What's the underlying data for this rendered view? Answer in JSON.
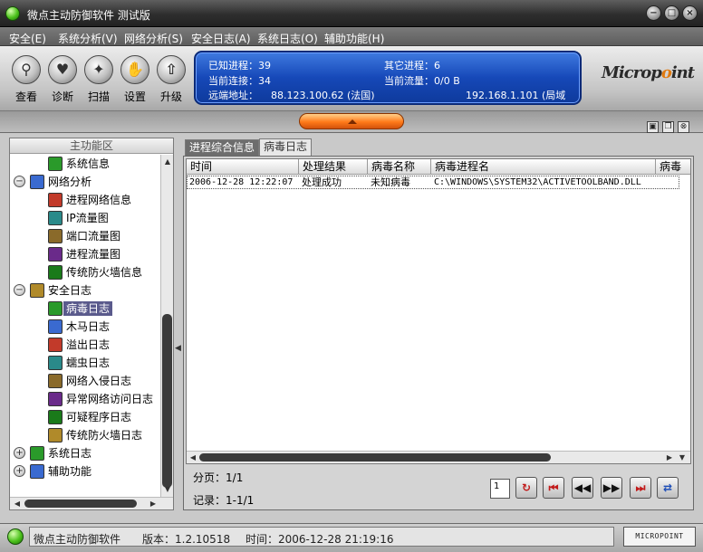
{
  "window": {
    "title": "微点主动防御软件  测试版"
  },
  "menu": [
    "安全(E)",
    "系统分析(V)",
    "网络分析(S)",
    "安全日志(A)",
    "系统日志(O)",
    "辅助功能(H)"
  ],
  "toolbar": [
    {
      "label": "查看",
      "icon": "magnifier-icon"
    },
    {
      "label": "诊断",
      "icon": "heart-check-icon"
    },
    {
      "label": "扫描",
      "icon": "scan-icon"
    },
    {
      "label": "设置",
      "icon": "hand-icon"
    },
    {
      "label": "升级",
      "icon": "upgrade-icon"
    }
  ],
  "info": {
    "known_proc_label": "已知进程：",
    "known_proc": "39",
    "other_proc_label": "其它进程：",
    "other_proc": "6",
    "conn_label": "当前连接：",
    "conn": "34",
    "traffic_label": "当前流量：",
    "traffic": "0/0 B",
    "remote_label": "远端地址：",
    "remote": "88.123.100.62 (法国)",
    "local": "192.168.1.101 (局域"
  },
  "brand": {
    "logo_pre": "Micrоp",
    "logo_o": "o",
    "logo_post": "int"
  },
  "left": {
    "header": "主功能区",
    "tree": [
      {
        "label": "系统信息",
        "level": 1
      },
      {
        "label": "网络分析",
        "level": 0,
        "exp": "−"
      },
      {
        "label": "进程网络信息",
        "level": 1
      },
      {
        "label": "IP流量图",
        "level": 1
      },
      {
        "label": "端口流量图",
        "level": 1
      },
      {
        "label": "进程流量图",
        "level": 1
      },
      {
        "label": "传统防火墙信息",
        "level": 1
      },
      {
        "label": "安全日志",
        "level": 0,
        "exp": "−"
      },
      {
        "label": "病毒日志",
        "level": 1,
        "selected": true
      },
      {
        "label": "木马日志",
        "level": 1
      },
      {
        "label": "溢出日志",
        "level": 1
      },
      {
        "label": "蠕虫日志",
        "level": 1
      },
      {
        "label": "网络入侵日志",
        "level": 1
      },
      {
        "label": "异常网络访问日志",
        "level": 1
      },
      {
        "label": "可疑程序日志",
        "level": 1
      },
      {
        "label": "传统防火墙日志",
        "level": 1
      },
      {
        "label": "系统日志",
        "level": 0,
        "exp": "+"
      },
      {
        "label": "辅助功能",
        "level": 0,
        "exp": "+"
      }
    ]
  },
  "tabs": [
    "进程综合信息",
    "病毒日志"
  ],
  "table": {
    "columns": [
      "时间",
      "处理结果",
      "病毒名称",
      "病毒进程名",
      "病毒"
    ],
    "rows": [
      [
        "2006-12-28 12:22:07",
        "处理成功",
        "未知病毒",
        "C:\\WINDOWS\\SYSTEM32\\ACTIVETOOLBAND.DLL",
        ""
      ]
    ]
  },
  "paging": {
    "page_label": "分页：",
    "page": "1/1",
    "record_label": "记录：",
    "record": "1-1/1",
    "page_input": "1"
  },
  "status": {
    "app": "微点主动防御软件",
    "version_label": "版本：",
    "version": "1.2.10518",
    "time_label": "时间：",
    "time": "2006-12-28 21:19:16",
    "logo": "MICROPOINT"
  },
  "colors": {
    "info_panel": "#1648b8",
    "selection": "#5a5a8c",
    "accent_orange": "#ff7a1a"
  }
}
